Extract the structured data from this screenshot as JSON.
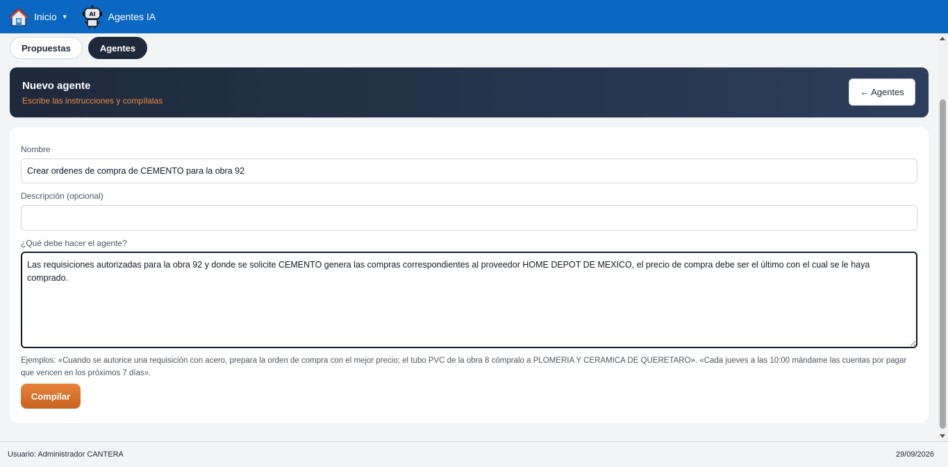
{
  "nav": {
    "home_label": "Inicio",
    "home_icon": "home-icon",
    "agents_label": "Agentes IA",
    "agents_icon": "robot-ai-icon",
    "robot_badge": "AI",
    "bar_color": "#0a67c2"
  },
  "tabs": [
    {
      "label": "Propuestas",
      "active": false
    },
    {
      "label": "Agentes",
      "active": true
    }
  ],
  "banner": {
    "title": "Nuevo agente",
    "subtitle": "Escribe las instrucciones y compílalas",
    "back_label": "← Agentes"
  },
  "form": {
    "name_label": "Nombre",
    "name_value": "Crear ordenes de compra de CEMENTO para la obra 92",
    "description_label": "Descripción (opcional)",
    "description_value": "",
    "instructions_label": "¿Qué debe hacer el agente?",
    "instructions_value": "Las requisiciones autorizadas para la obra 92 y donde se solicite CEMENTO genera las compras correspondientes al proveedor HOME DEPOT DE MEXICO, el precio de compra debe ser el último con el cual se le haya comprado.",
    "examples_text": "Ejemplos: «Cuando se autorice una requisición con acero, prepara la orden de compra con el mejor precio; el tubo PVC de la obra 8 cómpralo a PLOMERIA Y CERAMICA DE QUERETARO». «Cada jueves a las 10:00 mándame las cuentas por pagar que vencen en los próximos 7 días».",
    "compile_label": "Compilar"
  },
  "footer": {
    "user": "Usuario: Administrador CANTERA",
    "date": "29/09/2026"
  },
  "colors": {
    "accent": "#e07a35",
    "banner_bg": "#1e293b",
    "subtitle": "#f08a45"
  }
}
